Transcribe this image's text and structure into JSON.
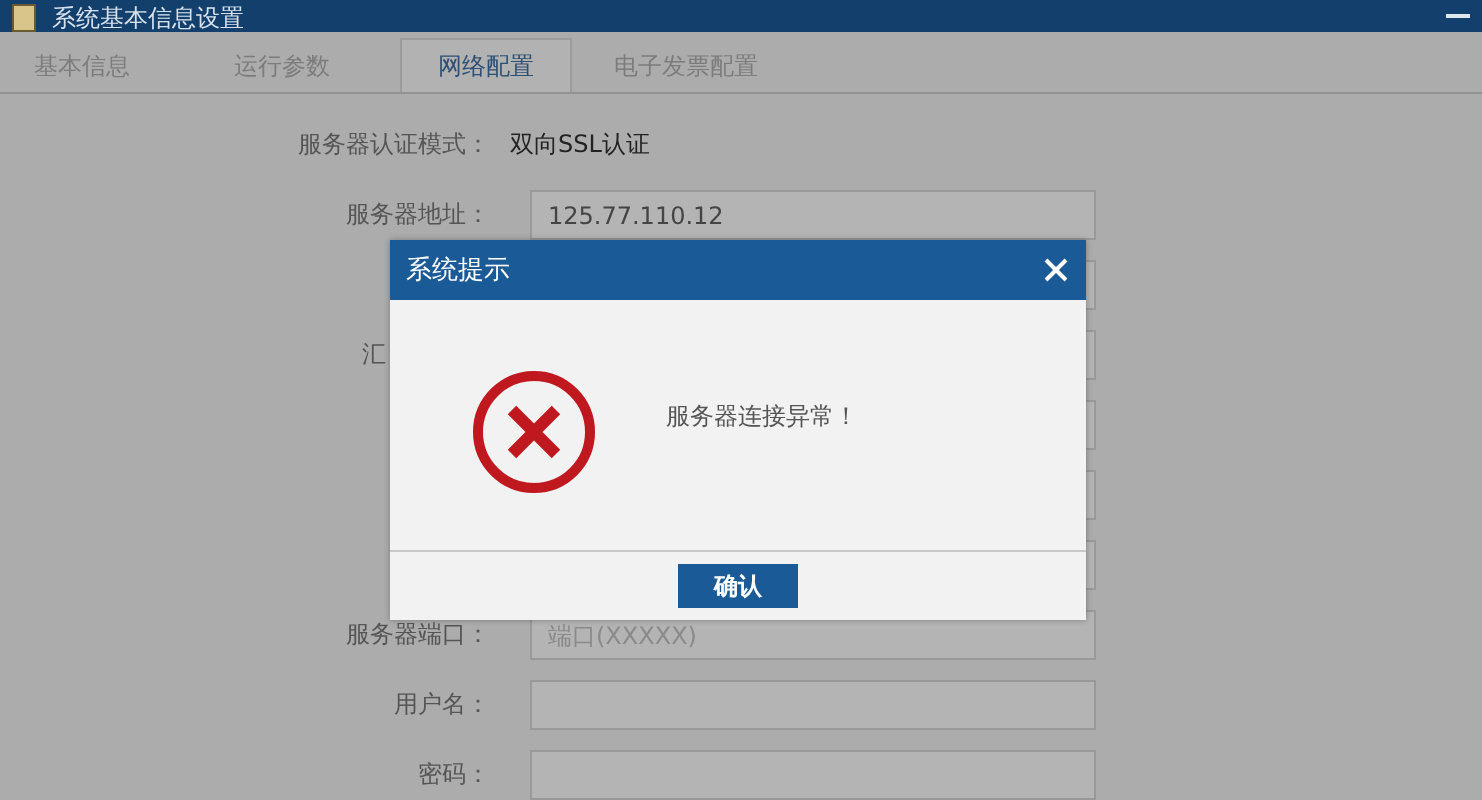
{
  "window": {
    "title": "系统基本信息设置"
  },
  "tabs": [
    {
      "label": "基本信息",
      "selected": false
    },
    {
      "label": "运行参数",
      "selected": false
    },
    {
      "label": "网络配置",
      "selected": true
    },
    {
      "label": "电子发票配置",
      "selected": false
    }
  ],
  "form": {
    "auth_mode": {
      "label": "服务器认证模式：",
      "value": "双向SSL认证"
    },
    "rows": [
      {
        "label": "服务器地址：",
        "value": "125.77.110.12"
      },
      {},
      {
        "label": "汇",
        "cut": true
      },
      {},
      {},
      {},
      {
        "label": "服务器端口：",
        "placeholder": "端口(XXXXX)"
      },
      {
        "label": "用户名："
      },
      {
        "label": "密码："
      }
    ]
  },
  "dialog": {
    "title": "系统提示",
    "message": "服务器连接异常！",
    "button": "确认"
  }
}
